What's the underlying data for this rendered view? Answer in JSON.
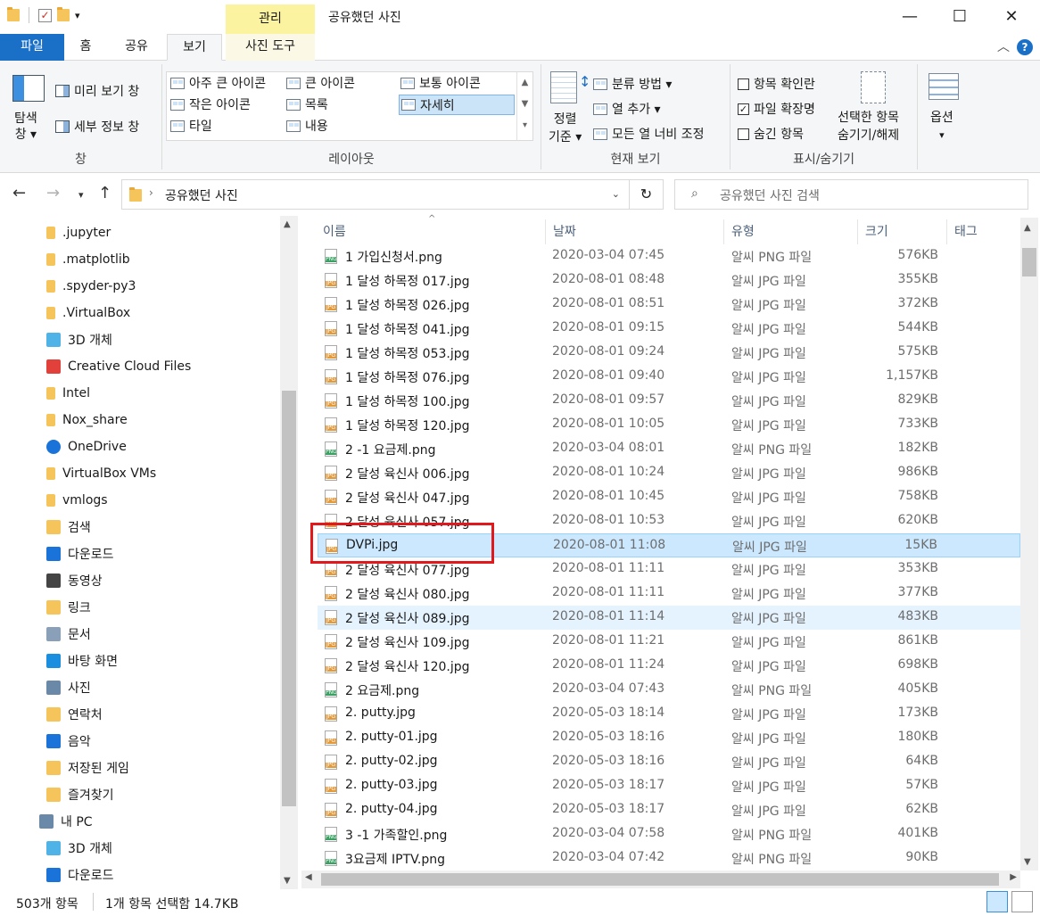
{
  "titlebar": {
    "context_tab": "관리",
    "title": "공유했던 사진",
    "minimize": "—",
    "maximize": "☐",
    "close": "✕"
  },
  "ribbon_tabs": [
    "파일",
    "홈",
    "공유",
    "보기",
    "사진 도구"
  ],
  "ribbon": {
    "pane_group": {
      "nav_pane": "탐색\n창 ▾",
      "nav_pane_line1": "탐색",
      "nav_pane_line2": "창 ▾",
      "preview": "미리 보기 창",
      "details": "세부 정보 창",
      "label": "창"
    },
    "layout_group": {
      "items": [
        "아주 큰 아이콘",
        "큰 아이콘",
        "보통 아이콘",
        "작은 아이콘",
        "목록",
        "자세히",
        "타일",
        "내용"
      ],
      "selected": "자세히",
      "label": "레이아웃"
    },
    "view_group": {
      "sort_line1": "정렬",
      "sort_line2": "기준 ▾",
      "group_by": "분류 방법 ▾",
      "add_column": "열 추가 ▾",
      "fit_columns": "모든 열 너비 조정",
      "label": "현재 보기"
    },
    "showhide_group": {
      "item_checkbox": "항목 확인란",
      "item_checkbox_checked": false,
      "file_ext": "파일 확장명",
      "file_ext_checked": true,
      "hidden_items": "숨긴 항목",
      "hidden_items_checked": false,
      "hide_selected_line1": "선택한 항목",
      "hide_selected_line2": "숨기기/해제",
      "label": "표시/숨기기"
    },
    "options": "옵션",
    "options_arrow": "▾"
  },
  "address": {
    "path": "공유했던 사진",
    "search_placeholder": "공유했던 사진 검색"
  },
  "nav_items": [
    {
      "label": ".jupyter",
      "icon": "folder-icon"
    },
    {
      "label": ".matplotlib",
      "icon": "folder-icon"
    },
    {
      "label": ".spyder-py3",
      "icon": "folder-icon"
    },
    {
      "label": ".VirtualBox",
      "icon": "folder-icon"
    },
    {
      "label": "3D 개체",
      "icon": "3d-objects-icon"
    },
    {
      "label": "Creative Cloud Files",
      "icon": "creative-cloud-icon"
    },
    {
      "label": "Intel",
      "icon": "folder-icon"
    },
    {
      "label": "Nox_share",
      "icon": "folder-icon"
    },
    {
      "label": "OneDrive",
      "icon": "onedrive-icon"
    },
    {
      "label": "VirtualBox VMs",
      "icon": "folder-icon"
    },
    {
      "label": "vmlogs",
      "icon": "folder-icon"
    },
    {
      "label": "검색",
      "icon": "search-folder-icon"
    },
    {
      "label": "다운로드",
      "icon": "download-icon"
    },
    {
      "label": "동영상",
      "icon": "video-icon"
    },
    {
      "label": "링크",
      "icon": "links-icon"
    },
    {
      "label": "문서",
      "icon": "document-icon"
    },
    {
      "label": "바탕 화면",
      "icon": "desktop-icon"
    },
    {
      "label": "사진",
      "icon": "pictures-icon"
    },
    {
      "label": "연락처",
      "icon": "contacts-icon"
    },
    {
      "label": "음악",
      "icon": "music-icon"
    },
    {
      "label": "저장된 게임",
      "icon": "saved-games-icon"
    },
    {
      "label": "즐겨찾기",
      "icon": "favorites-icon"
    },
    {
      "label": "내 PC",
      "icon": "pc-icon"
    },
    {
      "label": "3D 개체",
      "icon": "3d-objects-icon"
    },
    {
      "label": "다운로드",
      "icon": "download-icon"
    }
  ],
  "columns": [
    "이름",
    "날짜",
    "유형",
    "크기",
    "태그"
  ],
  "files": [
    {
      "name": "1 가입신청서.png",
      "date": "2020-03-04 07:45",
      "type": "알씨 PNG 파일",
      "size": "576KB",
      "kind": "png"
    },
    {
      "name": "1 달성 하목정 017.jpg",
      "date": "2020-08-01 08:48",
      "type": "알씨 JPG 파일",
      "size": "355KB",
      "kind": "jpg"
    },
    {
      "name": "1 달성 하목정 026.jpg",
      "date": "2020-08-01 08:51",
      "type": "알씨 JPG 파일",
      "size": "372KB",
      "kind": "jpg"
    },
    {
      "name": "1 달성 하목정 041.jpg",
      "date": "2020-08-01 09:15",
      "type": "알씨 JPG 파일",
      "size": "544KB",
      "kind": "jpg"
    },
    {
      "name": "1 달성 하목정 053.jpg",
      "date": "2020-08-01 09:24",
      "type": "알씨 JPG 파일",
      "size": "575KB",
      "kind": "jpg"
    },
    {
      "name": "1 달성 하목정 076.jpg",
      "date": "2020-08-01 09:40",
      "type": "알씨 JPG 파일",
      "size": "1,157KB",
      "kind": "jpg"
    },
    {
      "name": "1 달성 하목정 100.jpg",
      "date": "2020-08-01 09:57",
      "type": "알씨 JPG 파일",
      "size": "829KB",
      "kind": "jpg"
    },
    {
      "name": "1 달성 하목정 120.jpg",
      "date": "2020-08-01 10:05",
      "type": "알씨 JPG 파일",
      "size": "733KB",
      "kind": "jpg"
    },
    {
      "name": "2 -1 요금제.png",
      "date": "2020-03-04 08:01",
      "type": "알씨 PNG 파일",
      "size": "182KB",
      "kind": "png"
    },
    {
      "name": "2 달성 육신사 006.jpg",
      "date": "2020-08-01 10:24",
      "type": "알씨 JPG 파일",
      "size": "986KB",
      "kind": "jpg"
    },
    {
      "name": "2 달성 육신사 047.jpg",
      "date": "2020-08-01 10:45",
      "type": "알씨 JPG 파일",
      "size": "758KB",
      "kind": "jpg"
    },
    {
      "name": "2 달성 육신사 057.jpg",
      "date": "2020-08-01 10:53",
      "type": "알씨 JPG 파일",
      "size": "620KB",
      "kind": "jpg"
    },
    {
      "name": "DVPi.jpg",
      "date": "2020-08-01 11:08",
      "type": "알씨 JPG 파일",
      "size": "15KB",
      "kind": "jpg",
      "state": "sel"
    },
    {
      "name": "2 달성 육신사 077.jpg",
      "date": "2020-08-01 11:11",
      "type": "알씨 JPG 파일",
      "size": "353KB",
      "kind": "jpg"
    },
    {
      "name": "2 달성 육신사 080.jpg",
      "date": "2020-08-01 11:11",
      "type": "알씨 JPG 파일",
      "size": "377KB",
      "kind": "jpg"
    },
    {
      "name": "2 달성 육신사 089.jpg",
      "date": "2020-08-01 11:14",
      "type": "알씨 JPG 파일",
      "size": "483KB",
      "kind": "jpg",
      "state": "hover"
    },
    {
      "name": "2 달성 육신사 109.jpg",
      "date": "2020-08-01 11:21",
      "type": "알씨 JPG 파일",
      "size": "861KB",
      "kind": "jpg"
    },
    {
      "name": "2 달성 육신사 120.jpg",
      "date": "2020-08-01 11:24",
      "type": "알씨 JPG 파일",
      "size": "698KB",
      "kind": "jpg"
    },
    {
      "name": "2 요금제.png",
      "date": "2020-03-04 07:43",
      "type": "알씨 PNG 파일",
      "size": "405KB",
      "kind": "png"
    },
    {
      "name": "2. putty.jpg",
      "date": "2020-05-03 18:14",
      "type": "알씨 JPG 파일",
      "size": "173KB",
      "kind": "jpg"
    },
    {
      "name": "2. putty-01.jpg",
      "date": "2020-05-03 18:16",
      "type": "알씨 JPG 파일",
      "size": "180KB",
      "kind": "jpg"
    },
    {
      "name": "2. putty-02.jpg",
      "date": "2020-05-03 18:16",
      "type": "알씨 JPG 파일",
      "size": "64KB",
      "kind": "jpg"
    },
    {
      "name": "2. putty-03.jpg",
      "date": "2020-05-03 18:17",
      "type": "알씨 JPG 파일",
      "size": "57KB",
      "kind": "jpg"
    },
    {
      "name": "2. putty-04.jpg",
      "date": "2020-05-03 18:17",
      "type": "알씨 JPG 파일",
      "size": "62KB",
      "kind": "jpg"
    },
    {
      "name": "3 -1 가족할인.png",
      "date": "2020-03-04 07:58",
      "type": "알씨 PNG 파일",
      "size": "401KB",
      "kind": "png"
    },
    {
      "name": "3요금제 IPTV.png",
      "date": "2020-03-04 07:42",
      "type": "알씨 PNG 파일",
      "size": "90KB",
      "kind": "png"
    }
  ],
  "status": {
    "count": "503개 항목",
    "selection": "1개 항목 선택함 14.7KB"
  },
  "colors": {
    "file_tab": "#1a6fc6",
    "context_tab": "#fbf3a0",
    "selected_row": "#cce8ff",
    "highlight": "#e1191c"
  }
}
